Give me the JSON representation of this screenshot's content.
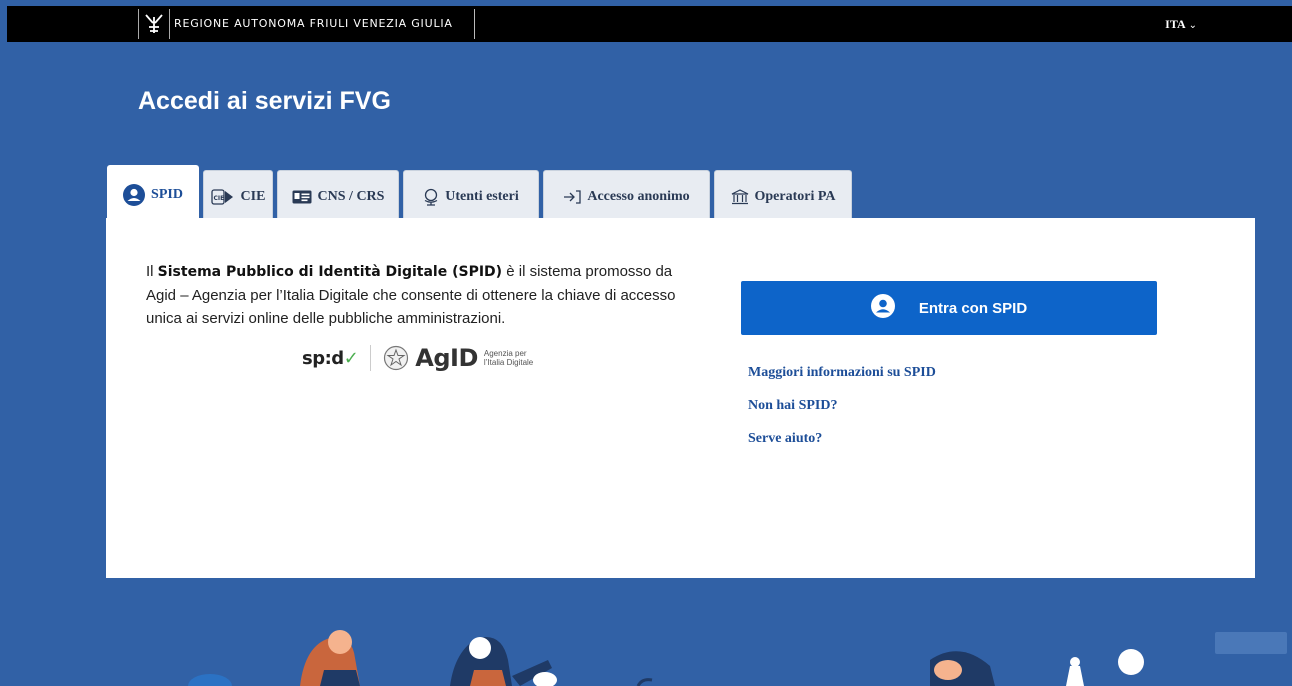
{
  "header": {
    "region_name": "REGIONE AUTONOMA FRIULI VENEZIA GIULIA",
    "language": "ITA"
  },
  "page": {
    "title": "Accedi ai servizi FVG"
  },
  "tabs": [
    {
      "label": "SPID",
      "icon": "user-circle-icon",
      "active": true
    },
    {
      "label": "CIE",
      "icon": "cie-card-icon",
      "active": false
    },
    {
      "label": "CNS / CRS",
      "icon": "id-card-icon",
      "active": false
    },
    {
      "label": "Utenti esteri",
      "icon": "globe-icon",
      "active": false
    },
    {
      "label": "Accesso anonimo",
      "icon": "login-arrow-icon",
      "active": false
    },
    {
      "label": "Operatori PA",
      "icon": "institution-icon",
      "active": false
    }
  ],
  "spid_panel": {
    "desc_prefix": "Il ",
    "desc_bold": "Sistema Pubblico di Identità Digitale (SPID)",
    "desc_rest": " è il sistema promosso da Agid – Agenzia per l’Italia Digitale che consente di ottenere la chiave di accesso unica ai servizi online delle pubbliche amministrazioni.",
    "spid_logo_text": "sp:d",
    "agid_logo_text": "AgID",
    "agid_sub_1": "Agenzia per",
    "agid_sub_2": "l’Italia Digitale",
    "login_button": "Entra con SPID",
    "links": [
      "Maggiori informazioni su SPID",
      "Non hai SPID?",
      "Serve aiuto?"
    ]
  },
  "colors": {
    "background": "#3161a6",
    "primary_button": "#0d64c9",
    "link": "#1d4e98",
    "topbar": "#000000"
  }
}
